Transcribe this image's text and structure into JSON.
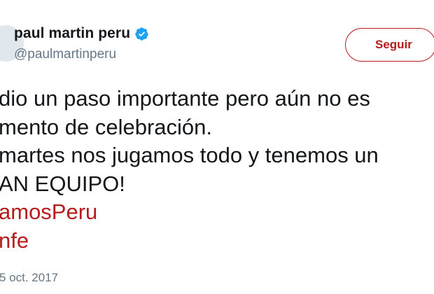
{
  "user": {
    "display_name": "paul martin peru",
    "handle": "@paulmartinperu",
    "verified": true,
    "verified_color": "#1da1f2"
  },
  "follow_button": {
    "label": "Seguir",
    "accent": "#b71c1c"
  },
  "tweet": {
    "lines": [
      "dio un paso importante pero aún no es",
      "mento de celebración.",
      "martes nos jugamos todo y tenemos un",
      "AN EQUIPO!"
    ],
    "hashtags": [
      "amosPeru",
      "nfe"
    ],
    "timestamp": "5 oct. 2017"
  }
}
